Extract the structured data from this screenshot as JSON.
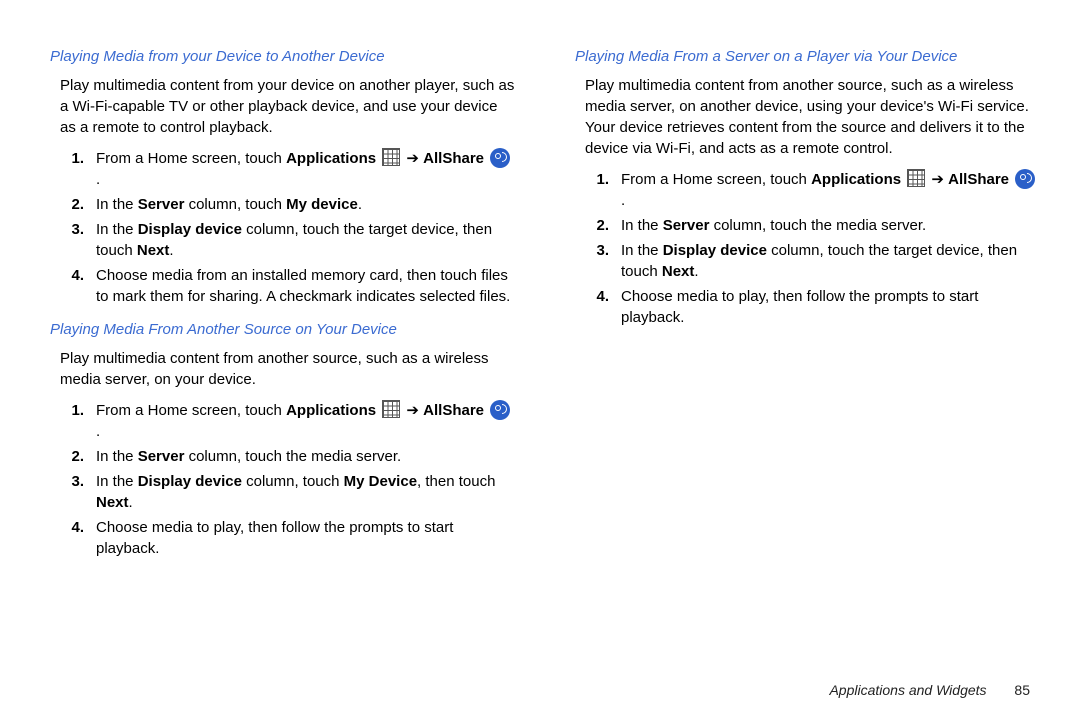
{
  "left": {
    "section1": {
      "heading": "Playing Media from your Device to Another Device",
      "intro": "Play multimedia content from your device on another player, such as  a Wi-Fi-capable TV or other playback device, and use your device as a remote to control playback.",
      "steps": {
        "s1a": "From a Home screen, touch ",
        "s1b": "Applications",
        "s1c": "AllShare",
        "s2a": "In the ",
        "s2b": "Server",
        "s2c": " column, touch ",
        "s2d": "My device",
        "s2e": ".",
        "s3a": "In the ",
        "s3b": "Display device",
        "s3c": " column, touch the target device, then touch ",
        "s3d": "Next",
        "s3e": ".",
        "s4": "Choose media from an installed memory card, then touch files to mark them for sharing. A checkmark indicates selected files."
      }
    },
    "section2": {
      "heading": "Playing Media From Another Source on Your Device",
      "intro": "Play multimedia content from another source, such as a wireless media server, on your device.",
      "steps": {
        "s1a": "From a Home screen, touch ",
        "s1b": "Applications",
        "s1c": "AllShare",
        "s2a": "In the ",
        "s2b": "Server",
        "s2c": " column, touch the media server.",
        "s3a": "In the ",
        "s3b": "Display device",
        "s3c": " column, touch ",
        "s3d": "My Device",
        "s3e": ", then touch ",
        "s3f": "Next",
        "s3g": ".",
        "s4": "Choose media to play, then follow the prompts to start playback."
      }
    }
  },
  "right": {
    "section1": {
      "heading": "Playing Media From a Server on a Player via Your Device",
      "intro": "Play multimedia content from another source, such as a wireless media server, on another device, using your device's Wi-Fi service. Your device retrieves content from the source and delivers it to the device via Wi-Fi, and acts as a remote control.",
      "steps": {
        "s1a": "From a Home screen, touch ",
        "s1b": "Applications",
        "s1c": "AllShare",
        "s2a": "In the ",
        "s2b": "Server",
        "s2c": " column, touch the media server.",
        "s3a": "In the ",
        "s3b": "Display device",
        "s3c": " column, touch the target device, then touch ",
        "s3d": "Next",
        "s3e": ".",
        "s4": "Choose media to play, then follow the prompts to start playback."
      }
    }
  },
  "footer": {
    "chapter": "Applications and Widgets",
    "page": "85"
  },
  "numbers": {
    "n1": "1.",
    "n2": "2.",
    "n3": "3.",
    "n4": "4."
  },
  "punct": {
    "arrow": " ➔ ",
    "period": " ."
  }
}
